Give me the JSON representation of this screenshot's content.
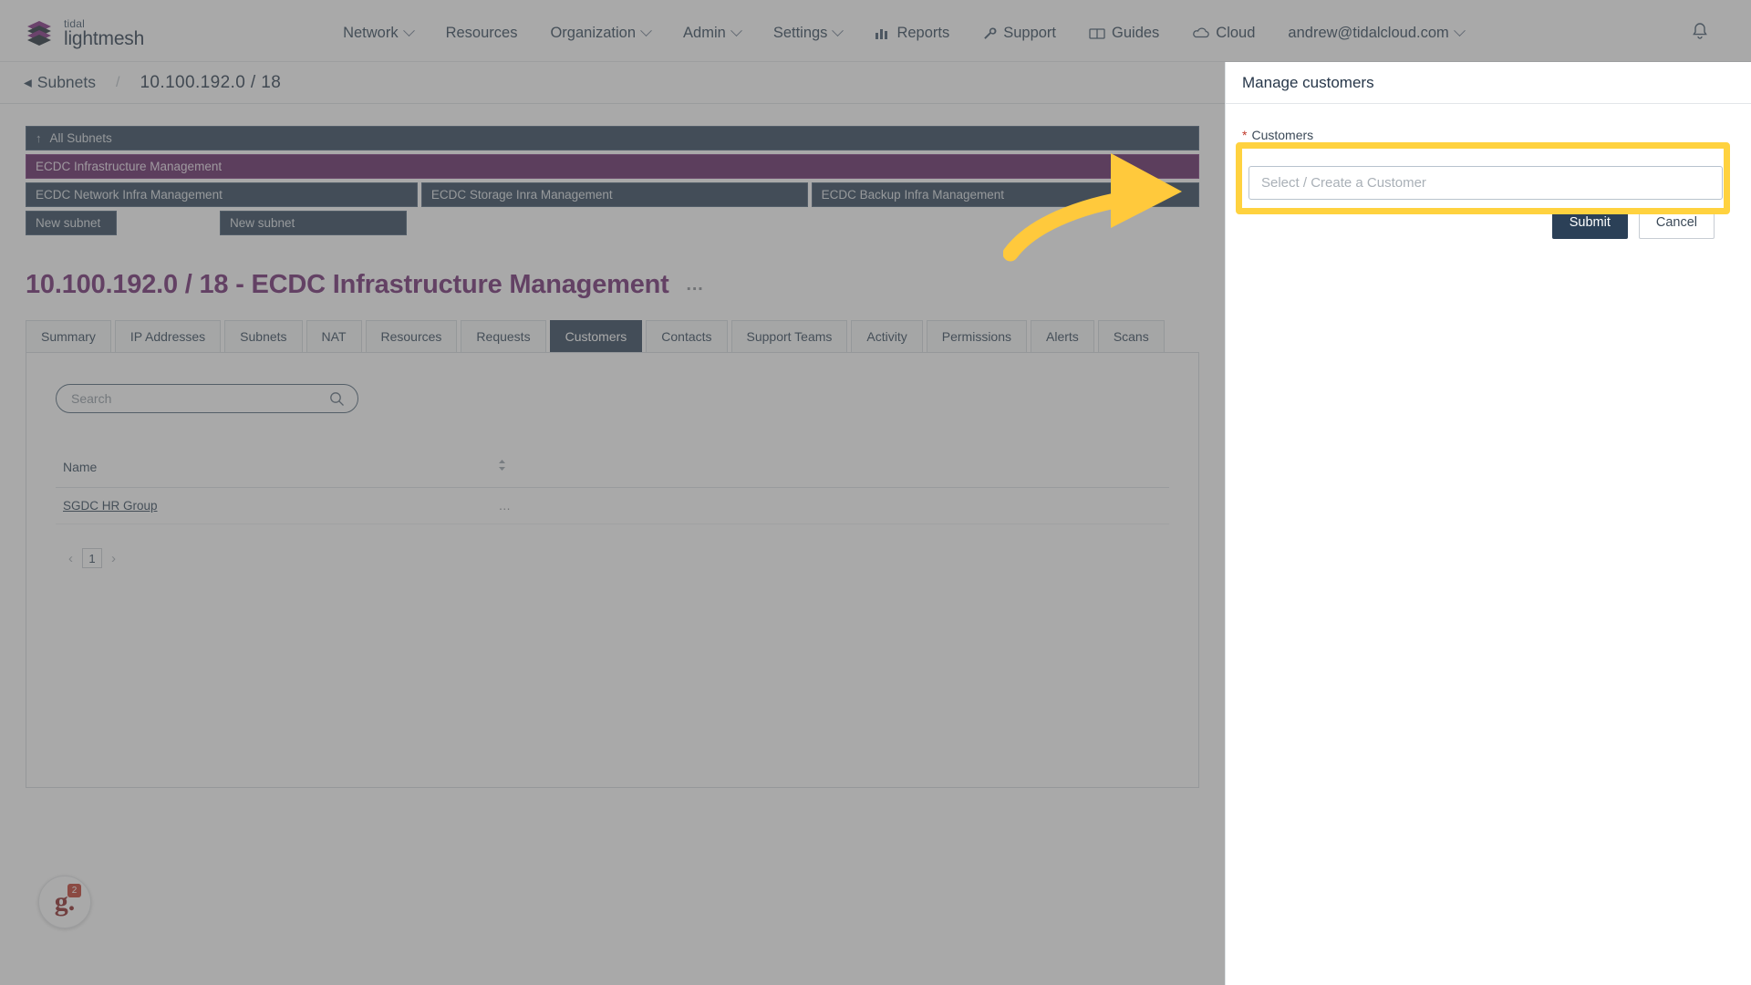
{
  "brand": {
    "top": "tidal",
    "bottom": "lightmesh",
    "logo_icon": "stacked-layers-icon",
    "purple": "#6d2670",
    "navy": "#2b4057"
  },
  "topnav": {
    "items": [
      {
        "label": "Network",
        "caret": true
      },
      {
        "label": "Resources",
        "caret": false
      },
      {
        "label": "Organization",
        "caret": true
      },
      {
        "label": "Admin",
        "caret": true
      },
      {
        "label": "Settings",
        "caret": true
      }
    ],
    "right_items": [
      {
        "label": "Reports",
        "icon": "bar-chart-icon",
        "caret": false
      },
      {
        "label": "Support",
        "icon": "wrench-icon",
        "caret": false
      },
      {
        "label": "Guides",
        "icon": "book-icon",
        "caret": false
      },
      {
        "label": "Cloud",
        "icon": "cloud-icon",
        "caret": false
      },
      {
        "label": "andrew@tidalcloud.com",
        "icon": "",
        "caret": true
      }
    ],
    "bell_icon": "notification-bell-icon"
  },
  "breadcrumb": {
    "back_label": "Subnets",
    "separator": "/",
    "current": "10.100.192.0 / 18"
  },
  "tree": {
    "root": {
      "label": "All Subnets",
      "up_arrow": "↑"
    },
    "selected": {
      "label": "ECDC Infrastructure Management"
    },
    "children": [
      {
        "label": "ECDC Network Infra Management"
      },
      {
        "label": "ECDC Storage Inra Management"
      },
      {
        "label": "ECDC Backup Infra Management"
      }
    ],
    "new_subnet_buttons": [
      {
        "label": "New subnet"
      },
      {
        "label": "New subnet"
      }
    ]
  },
  "page": {
    "title": "10.100.192.0 / 18 - ECDC Infrastructure Management",
    "title_menu": "…",
    "tabs": [
      {
        "label": "Summary",
        "active": false
      },
      {
        "label": "IP Addresses",
        "active": false
      },
      {
        "label": "Subnets",
        "active": false
      },
      {
        "label": "NAT",
        "active": false
      },
      {
        "label": "Resources",
        "active": false
      },
      {
        "label": "Requests",
        "active": false
      },
      {
        "label": "Customers",
        "active": true
      },
      {
        "label": "Contacts",
        "active": false
      },
      {
        "label": "Support Teams",
        "active": false
      },
      {
        "label": "Activity",
        "active": false
      },
      {
        "label": "Permissions",
        "active": false
      },
      {
        "label": "Alerts",
        "active": false
      },
      {
        "label": "Scans",
        "active": false
      }
    ]
  },
  "search": {
    "placeholder": "Search",
    "value": "",
    "icon": "search-icon"
  },
  "table": {
    "columns": [
      "Name"
    ],
    "sort_icon": "sort-updown-icon",
    "rows": [
      {
        "name": "SGDC HR Group",
        "menu": "…"
      }
    ]
  },
  "pagination": {
    "prev": "‹",
    "next": "›",
    "pages": [
      "1"
    ],
    "current": "1"
  },
  "g2_badge": {
    "letter": "g.",
    "superscript": "2"
  },
  "drawer": {
    "title": "Manage customers",
    "field_label": "Customers",
    "required_marker": "*",
    "input_placeholder": "Select / Create a Customer",
    "input_value": "",
    "submit_label": "Submit",
    "cancel_label": "Cancel"
  },
  "annotation": {
    "arrow_color": "#ffc93c",
    "highlight_color": "#ffd23f"
  }
}
